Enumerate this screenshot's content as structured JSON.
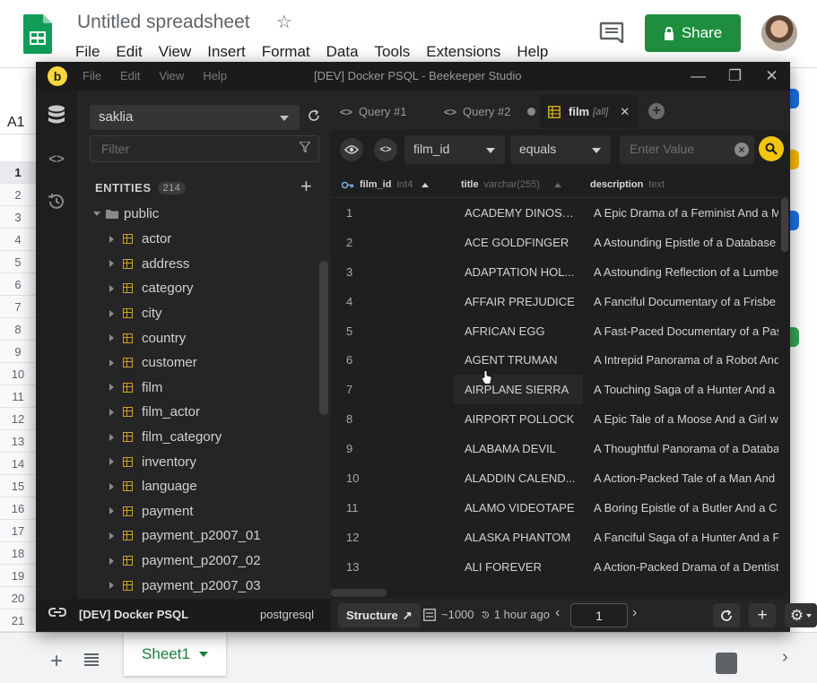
{
  "sheets": {
    "title": "Untitled spreadsheet",
    "menu": [
      "File",
      "Edit",
      "View",
      "Insert",
      "Format",
      "Data",
      "Tools",
      "Extensions",
      "Help"
    ],
    "share_label": "Share",
    "namebox": "A1",
    "row_numbers": [
      "1",
      "2",
      "3",
      "4",
      "5",
      "6",
      "7",
      "8",
      "9",
      "10",
      "11",
      "12",
      "13",
      "14",
      "15",
      "16",
      "17",
      "18",
      "19",
      "20",
      "21"
    ],
    "sheet_tab": "Sheet1",
    "brand_color": "#1e8e3e"
  },
  "beekeeper": {
    "menu": [
      "File",
      "Edit",
      "View",
      "Help"
    ],
    "window_title": "[DEV] Docker PSQL - Beekeeper Studio",
    "sidebar": {
      "connection": "saklia",
      "filter_placeholder": "Filter",
      "entities_label": "ENTITIES",
      "entities_count": "214",
      "schema": "public",
      "tables": [
        "actor",
        "address",
        "category",
        "city",
        "country",
        "customer",
        "film",
        "film_actor",
        "film_category",
        "inventory",
        "language",
        "payment",
        "payment_p2007_01",
        "payment_p2007_02",
        "payment_p2007_03"
      ]
    },
    "tabs": [
      {
        "label": "Query #1",
        "icon": "code-icon"
      },
      {
        "label": "Query #2",
        "icon": "code-icon"
      },
      {
        "label": "film",
        "suffix": "[all]",
        "icon": "table-icon"
      }
    ],
    "filter": {
      "column": "film_id",
      "operator": "equals",
      "value_placeholder": "Enter Value"
    },
    "columns": [
      {
        "name": "film_id",
        "type": "int4"
      },
      {
        "name": "title",
        "type": "varchar(255)"
      },
      {
        "name": "description",
        "type": "text"
      }
    ],
    "rows": [
      {
        "id": "1",
        "title": "ACADEMY DINOSA...",
        "desc": "A Epic Drama of a Feminist And a M"
      },
      {
        "id": "2",
        "title": "ACE GOLDFINGER",
        "desc": "A Astounding Epistle of a Database"
      },
      {
        "id": "3",
        "title": "ADAPTATION HOL...",
        "desc": "A Astounding Reflection of a Lumbe"
      },
      {
        "id": "4",
        "title": "AFFAIR PREJUDICE",
        "desc": "A Fanciful Documentary of a Frisbe"
      },
      {
        "id": "5",
        "title": "AFRICAN EGG",
        "desc": "A Fast-Paced Documentary of a Pas"
      },
      {
        "id": "6",
        "title": "AGENT TRUMAN",
        "desc": "A Intrepid Panorama of a Robot And"
      },
      {
        "id": "7",
        "title": "AIRPLANE SIERRA",
        "desc": "A Touching Saga of a Hunter And a"
      },
      {
        "id": "8",
        "title": "AIRPORT POLLOCK",
        "desc": "A Epic Tale of a Moose And a Girl w"
      },
      {
        "id": "9",
        "title": "ALABAMA DEVIL",
        "desc": "A Thoughtful Panorama of a Databa"
      },
      {
        "id": "10",
        "title": "ALADDIN CALEND...",
        "desc": "A Action-Packed Tale of a Man And"
      },
      {
        "id": "11",
        "title": "ALAMO VIDEOTAPE",
        "desc": "A Boring Epistle of a Butler And a C"
      },
      {
        "id": "12",
        "title": "ALASKA PHANTOM",
        "desc": "A Fanciful Saga of a Hunter And a F"
      },
      {
        "id": "13",
        "title": "ALI FOREVER",
        "desc": "A Action-Packed Drama of a Dentist"
      }
    ],
    "status": {
      "connection_name": "[DEV] Docker PSQL",
      "db_type": "postgresql",
      "structure_label": "Structure",
      "row_count": "~1000",
      "last_run": "1 hour ago",
      "page": "1"
    },
    "accent_color": "#f1c40f"
  }
}
